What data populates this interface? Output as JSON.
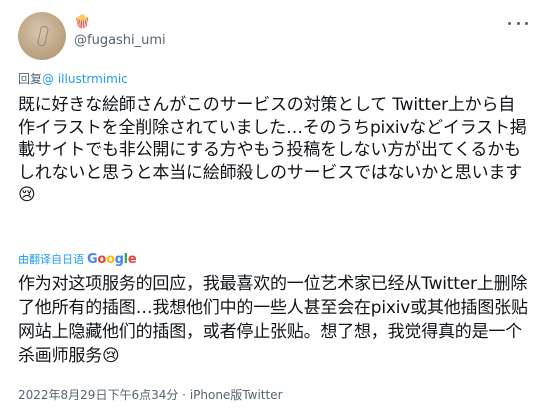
{
  "author": {
    "handle": "@fugashi_umi",
    "badge_emoji": "🍿"
  },
  "reply": {
    "prefix": "回复",
    "mention": "@ illustrmimic"
  },
  "tweet": {
    "text": "既に好きな絵師さんがこのサービスの対策として Twitter上から自作イラストを全削除されていました…そのうちpixivなどイラスト掲載サイトでも非公開にする方やもう投稿をしない方が出てくるかもしれないと思うと本当に絵師殺しのサービスではないかと思います😢"
  },
  "translation": {
    "label": "由翻译自日语",
    "provider": "Google",
    "text": "作为对这项服务的回应，我最喜欢的一位艺术家已经从Twitter上删除了他所有的插图…我想他们中的一些人甚至会在pixiv或其他插图张贴网站上隐藏他们的插图，或者停止张贴。想了想，我觉得真的是一个杀画师服务😢"
  },
  "meta": {
    "datetime": "2022年8月29日下午6点34分",
    "separator": " · ",
    "source": "iPhone版Twitter"
  },
  "colors": {
    "accent": "#1d9bf0",
    "secondary_text": "#536471",
    "primary_text": "#0f1419"
  }
}
